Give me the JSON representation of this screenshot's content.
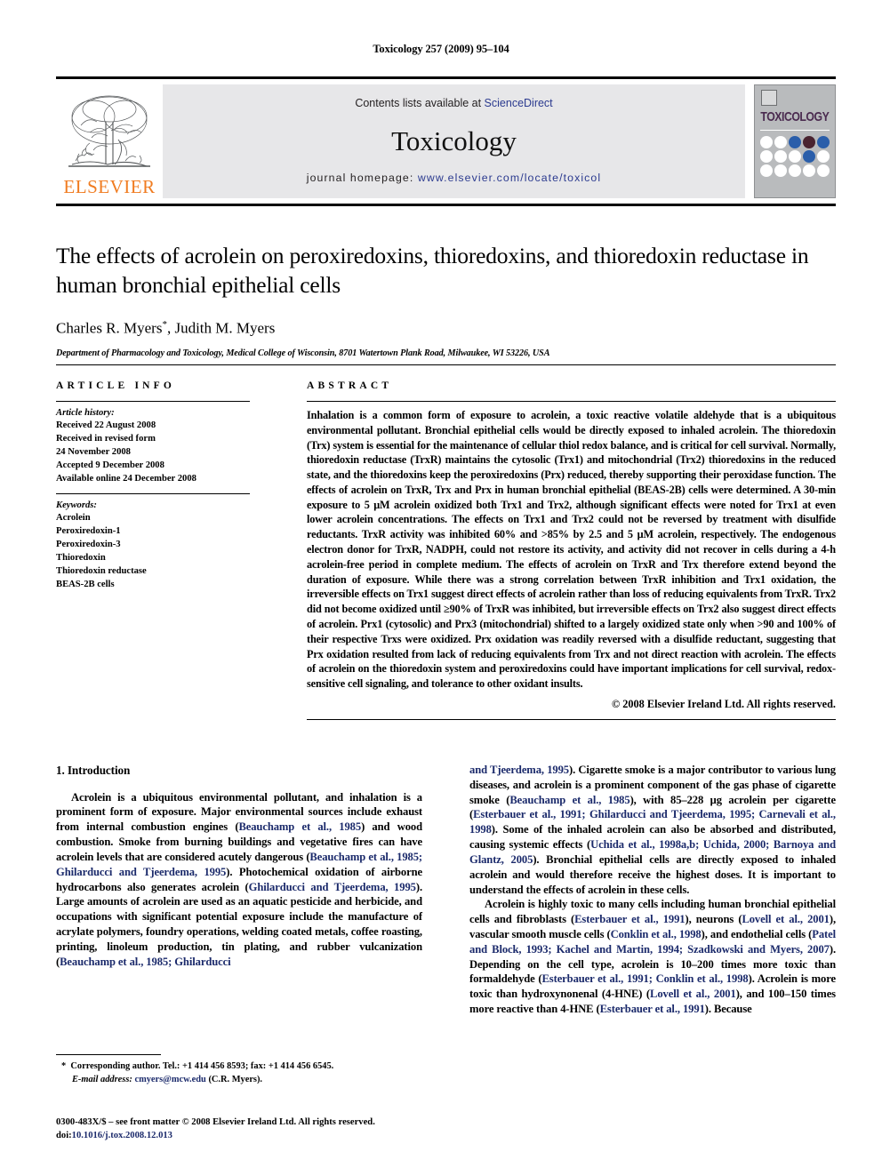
{
  "running_head": "Toxicology 257 (2009) 95–104",
  "masthead": {
    "publisher_name": "ELSEVIER",
    "contents_prefix": "Contents lists available at ",
    "contents_link": "ScienceDirect",
    "journal_name": "Toxicology",
    "homepage_prefix": "journal homepage: ",
    "homepage_url": "www.elsevier.com/locate/toxicol",
    "cover_title": "TOXICOLOGY",
    "cover_dot_colors": [
      "#ffffff",
      "#ffffff",
      "#2a5eaa",
      "#4a2430",
      "#2a5eaa",
      "#ffffff",
      "#ffffff",
      "#ffffff",
      "#2a5eaa",
      "#ffffff",
      "#ffffff",
      "#ffffff",
      "#ffffff",
      "#ffffff",
      "#ffffff"
    ]
  },
  "article": {
    "title": "The effects of acrolein on peroxiredoxins, thioredoxins, and thioredoxin reductase in human bronchial epithelial cells",
    "authors": "Charles R. Myers",
    "authors_rest": ", Judith M. Myers",
    "author_marker": "*",
    "affiliation": "Department of Pharmacology and Toxicology, Medical College of Wisconsin, 8701 Watertown Plank Road, Milwaukee, WI 53226, USA"
  },
  "article_info": {
    "heading": "ARTICLE INFO",
    "history_label": "Article history:",
    "history": [
      "Received 22 August 2008",
      "Received in revised form",
      "24 November 2008",
      "Accepted 9 December 2008",
      "Available online 24 December 2008"
    ],
    "keywords_label": "Keywords:",
    "keywords": [
      "Acrolein",
      "Peroxiredoxin-1",
      "Peroxiredoxin-3",
      "Thioredoxin",
      "Thioredoxin reductase",
      "BEAS-2B cells"
    ]
  },
  "abstract": {
    "heading": "ABSTRACT",
    "body": "Inhalation is a common form of exposure to acrolein, a toxic reactive volatile aldehyde that is a ubiquitous environmental pollutant. Bronchial epithelial cells would be directly exposed to inhaled acrolein. The thioredoxin (Trx) system is essential for the maintenance of cellular thiol redox balance, and is critical for cell survival. Normally, thioredoxin reductase (TrxR) maintains the cytosolic (Trx1) and mitochondrial (Trx2) thioredoxins in the reduced state, and the thioredoxins keep the peroxiredoxins (Prx) reduced, thereby supporting their peroxidase function. The effects of acrolein on TrxR, Trx and Prx in human bronchial epithelial (BEAS-2B) cells were determined. A 30-min exposure to 5 μM acrolein oxidized both Trx1 and Trx2, although significant effects were noted for Trx1 at even lower acrolein concentrations. The effects on Trx1 and Trx2 could not be reversed by treatment with disulfide reductants. TrxR activity was inhibited 60% and >85% by 2.5 and 5 μM acrolein, respectively. The endogenous electron donor for TrxR, NADPH, could not restore its activity, and activity did not recover in cells during a 4-h acrolein-free period in complete medium. The effects of acrolein on TrxR and Trx therefore extend beyond the duration of exposure. While there was a strong correlation between TrxR inhibition and Trx1 oxidation, the irreversible effects on Trx1 suggest direct effects of acrolein rather than loss of reducing equivalents from TrxR. Trx2 did not become oxidized until ≥90% of TrxR was inhibited, but irreversible effects on Trx2 also suggest direct effects of acrolein. Prx1 (cytosolic) and Prx3 (mitochondrial) shifted to a largely oxidized state only when >90 and 100% of their respective Trxs were oxidized. Prx oxidation was readily reversed with a disulfide reductant, suggesting that Prx oxidation resulted from lack of reducing equivalents from Trx and not direct reaction with acrolein. The effects of acrolein on the thioredoxin system and peroxiredoxins could have important implications for cell survival, redox-sensitive cell signaling, and tolerance to other oxidant insults.",
    "copyright": "© 2008 Elsevier Ireland Ltd. All rights reserved."
  },
  "introduction": {
    "section_number_title": "1.  Introduction",
    "left_p1_a": "Acrolein is a ubiquitous environmental pollutant, and inhalation is a prominent form of exposure. Major environmental sources include exhaust from internal combustion engines (",
    "left_cite1": "Beauchamp et al., 1985",
    "left_p1_b": ") and wood combustion. Smoke from burning buildings and vegetative fires can have acrolein levels that are considered acutely dangerous (",
    "left_cite2": "Beauchamp et al., 1985; Ghilarducci and Tjeerdema, 1995",
    "left_p1_c": "). Photochemical oxidation of airborne hydrocarbons also generates acrolein (",
    "left_cite3": "Ghilarducci and Tjeerdema, 1995",
    "left_p1_d": "). Large amounts of acrolein are used as an aquatic pesticide and herbicide, and occupations with significant potential exposure include the manufacture of acrylate polymers, foundry operations, welding coated metals, coffee roasting, printing, linoleum production, tin plating, and rubber vulcanization (",
    "left_cite4": "Beauchamp et al., 1985; Ghilarducci",
    "right_p1_cite0": "and Tjeerdema, 1995",
    "right_p1_a": "). Cigarette smoke is a major contributor to various lung diseases, and acrolein is a prominent component of the gas phase of cigarette smoke (",
    "right_cite1": "Beauchamp et al., 1985",
    "right_p1_b": "), with 85–228 μg acrolein per cigarette (",
    "right_cite2": "Esterbauer et al., 1991; Ghilarducci and Tjeerdema, 1995; Carnevali et al., 1998",
    "right_p1_c": "). Some of the inhaled acrolein can also be absorbed and distributed, causing systemic effects (",
    "right_cite3": "Uchida et al., 1998a,b; Uchida, 2000; Barnoya and Glantz, 2005",
    "right_p1_d": "). Bronchial epithelial cells are directly exposed to inhaled acrolein and would therefore receive the highest doses. It is important to understand the effects of acrolein in these cells.",
    "right_p2_a": "Acrolein is highly toxic to many cells including human bronchial epithelial cells and fibroblasts (",
    "right_p2_cite1": "Esterbauer et al., 1991",
    "right_p2_b": "), neurons (",
    "right_p2_cite2": "Lovell et al., 2001",
    "right_p2_c": "), vascular smooth muscle cells (",
    "right_p2_cite3": "Conklin et al., 1998",
    "right_p2_d": "), and endothelial cells (",
    "right_p2_cite4": "Patel and Block, 1993; Kachel and Martin, 1994; Szadkowski and Myers, 2007",
    "right_p2_e": "). Depending on the cell type, acrolein is 10–200 times more toxic than formaldehyde (",
    "right_p2_cite5": "Esterbauer et al., 1991; Conklin et al., 1998",
    "right_p2_f": "). Acrolein is more toxic than hydroxynonenal (4-HNE) (",
    "right_p2_cite6": "Lovell et al., 2001",
    "right_p2_g": "), and 100–150 times more reactive than 4-HNE (",
    "right_p2_cite7": "Esterbauer et al., 1991",
    "right_p2_h": "). Because"
  },
  "footnotes": {
    "marker": "*",
    "corresponding_text": "Corresponding author. Tel.: +1 414 456 8593; fax: +1 414 456 6545.",
    "email_label": "E-mail address:",
    "email": "cmyers@mcw.edu",
    "email_suffix": "(C.R. Myers).",
    "issn_line": "0300-483X/$ – see front matter © 2008 Elsevier Ireland Ltd. All rights reserved.",
    "doi_label": "doi:",
    "doi": "10.1016/j.tox.2008.12.013"
  },
  "colors": {
    "link": "#1b2a6b",
    "elsevier_orange": "#f07c21",
    "banner_gray": "#e7e7e9",
    "cover_gray": "#b9bbbd",
    "cover_title": "#4a2a4f"
  }
}
